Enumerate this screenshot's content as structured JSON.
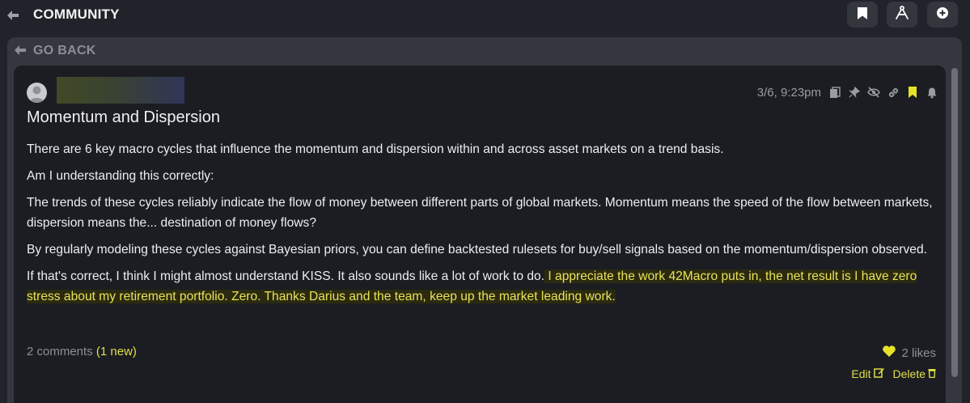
{
  "header": {
    "title": "COMMUNITY",
    "back_icon": "arrow-left-icon",
    "buttons": [
      {
        "icon": "bookmark-icon"
      },
      {
        "icon": "compass-tool-icon"
      },
      {
        "icon": "plus-circle-icon"
      }
    ]
  },
  "nav": {
    "go_back_label": "GO BACK"
  },
  "post": {
    "timestamp": "3/6, 9:23pm",
    "meta_icons": [
      "copy-icon",
      "pin-icon",
      "hide-icon",
      "link-icon",
      "bookmark-icon",
      "bell-icon"
    ],
    "title": "Momentum and Dispersion",
    "paragraphs": [
      "There are 6 key macro cycles that influence the momentum and dispersion within and across asset markets on a trend basis.",
      "Am I understanding this correctly:",
      "The trends of these cycles reliably indicate the flow of money between different parts of global markets. Momentum means the speed of the flow between markets, dispersion means the... destination of money flows?",
      "By regularly modeling these cycles against Bayesian priors, you can define backtested rulesets for buy/sell signals based on the momentum/dispersion observed."
    ],
    "last_paragraph_plain": "If that's correct, I think I might almost understand KISS. It also sounds like a lot of work to do.",
    "last_paragraph_highlight": " I appreciate the work 42Macro puts in, the net result is I have zero stress about my retirement portfolio. Zero. Thanks Darius and the team, keep up the market leading work.",
    "comments_label": "2 comments",
    "comments_new": "(1 new)",
    "likes_label": "2 likes",
    "edit_label": "Edit",
    "delete_label": "Delete"
  },
  "colors": {
    "background": "#202329",
    "panel": "#34373e",
    "card": "#1b1d22",
    "accent_yellow": "#e2df4b",
    "highlight_bg": "#2b2a10"
  }
}
